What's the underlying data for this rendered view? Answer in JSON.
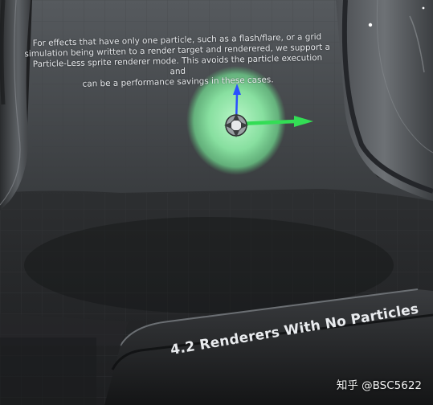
{
  "description_lines": "For effects that have only one particle, such as a flash/flare, or a grid\nsimulation being written to a render target and renderered, we support a\nParticle-Less sprite renderer mode. This avoids the particle execution and\ncan be a performance savings in these cases.",
  "section_title": "4.2  Renderers With No Particles",
  "watermark": "知乎 @BSC5622",
  "icons": {
    "gizmo": "transform-gizmo-icon",
    "glow": "green-sprite-glow"
  },
  "colors": {
    "glow": "#9cf0b4",
    "gizmo_x": "#33dd55",
    "gizmo_z": "#2a4fff",
    "background": "#232426"
  }
}
